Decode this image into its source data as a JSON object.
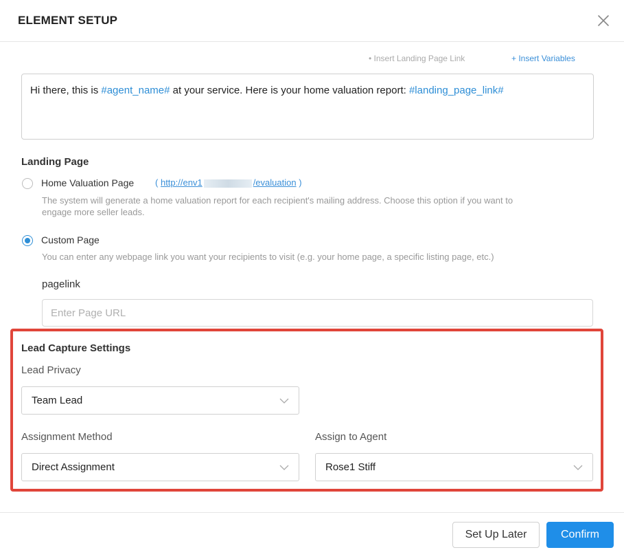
{
  "header": {
    "title": "ELEMENT SETUP",
    "close_icon": "close-icon"
  },
  "message_toolbar": {
    "insert_landing_page_link": "Insert Landing Page Link",
    "insert_variables": "Insert Variables"
  },
  "message": {
    "text_before_agent": "Hi there, this is ",
    "agent_variable": "#agent_name#",
    "text_middle": " at your service. Here is your home valuation report: ",
    "link_variable": "#landing_page_link#"
  },
  "landing_page": {
    "title": "Landing Page",
    "home_valuation": {
      "label": "Home Valuation Page",
      "url_open": "(",
      "url_start": "http://env1",
      "url_end": "/evaluation",
      "url_close": ")",
      "description_line1": "The system will generate a home valuation report for each recipient's mailing address. Choose this option if you want to",
      "description_line2": "engage more seller leads.",
      "checked": false
    },
    "custom_page": {
      "label": "Custom Page",
      "description": "You can enter any webpage link you want your recipients to visit (e.g. your home page, a specific listing page, etc.)",
      "checked": true
    },
    "pagelink": {
      "label": "pagelink",
      "value": "",
      "placeholder": "Enter Page URL"
    }
  },
  "lead_capture": {
    "title": "Lead Capture Settings",
    "lead_privacy": {
      "label": "Lead Privacy",
      "value": "Team Lead"
    },
    "assignment_method": {
      "label": "Assignment Method",
      "value": "Direct Assignment"
    },
    "assign_to_agent": {
      "label": "Assign to Agent",
      "value": "Rose1 Stiff"
    }
  },
  "footer": {
    "set_up_later": "Set Up Later",
    "confirm": "Confirm"
  },
  "colors": {
    "accent": "#1f8ee8",
    "link": "#3a8fd8",
    "highlight_border": "#e0453a"
  }
}
